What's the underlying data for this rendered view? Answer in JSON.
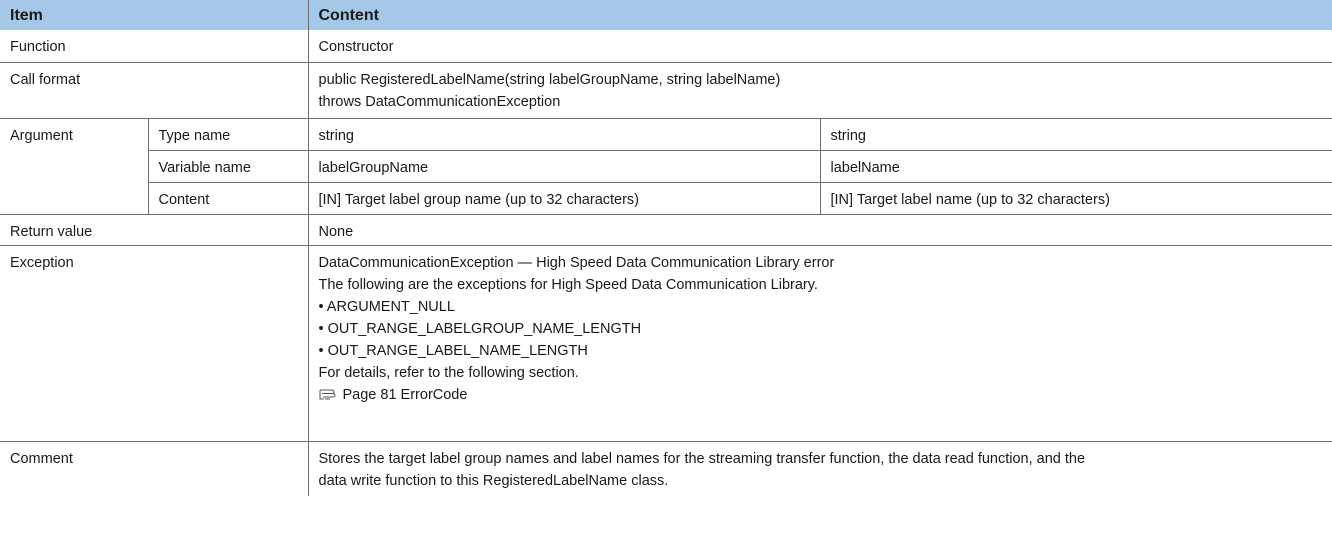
{
  "header": {
    "item": "Item",
    "content": "Content"
  },
  "function": {
    "label": "Function",
    "value": "Constructor"
  },
  "call_format": {
    "label": "Call format",
    "lines": [
      "public RegisteredLabelName(string labelGroupName, string labelName)",
      "throws DataCommunicationException"
    ]
  },
  "argument": {
    "label": "Argument",
    "rows": [
      {
        "sub": "Type name",
        "col1": "string",
        "col2": "string"
      },
      {
        "sub": "Variable name",
        "col1": "labelGroupName",
        "col2": "labelName"
      },
      {
        "sub": "Content",
        "col1": "[IN] Target label group name (up to 32 characters)",
        "col2": "[IN] Target label name (up to 32 characters)"
      }
    ]
  },
  "return_value": {
    "label": "Return value",
    "value": "None"
  },
  "exception": {
    "label": "Exception",
    "lines": [
      "DataCommunicationException — High Speed Data Communication Library error",
      "The following are the exceptions for High Speed Data Communication Library.",
      "• ARGUMENT_NULL",
      "• OUT_RANGE_LABELGROUP_NAME_LENGTH",
      "• OUT_RANGE_LABEL_NAME_LENGTH",
      "For details, refer to the following section."
    ],
    "reference": "Page 81 ErrorCode",
    "reference_icon": "pointing-hand-icon"
  },
  "comment": {
    "label": "Comment",
    "lines": [
      "Stores the target label group names and label names for the streaming transfer function, the data read function, and the",
      "data write function to this RegisteredLabelName class."
    ]
  },
  "colors": {
    "header_bg": "#a5c8e8",
    "border": "#6e6e6e"
  }
}
